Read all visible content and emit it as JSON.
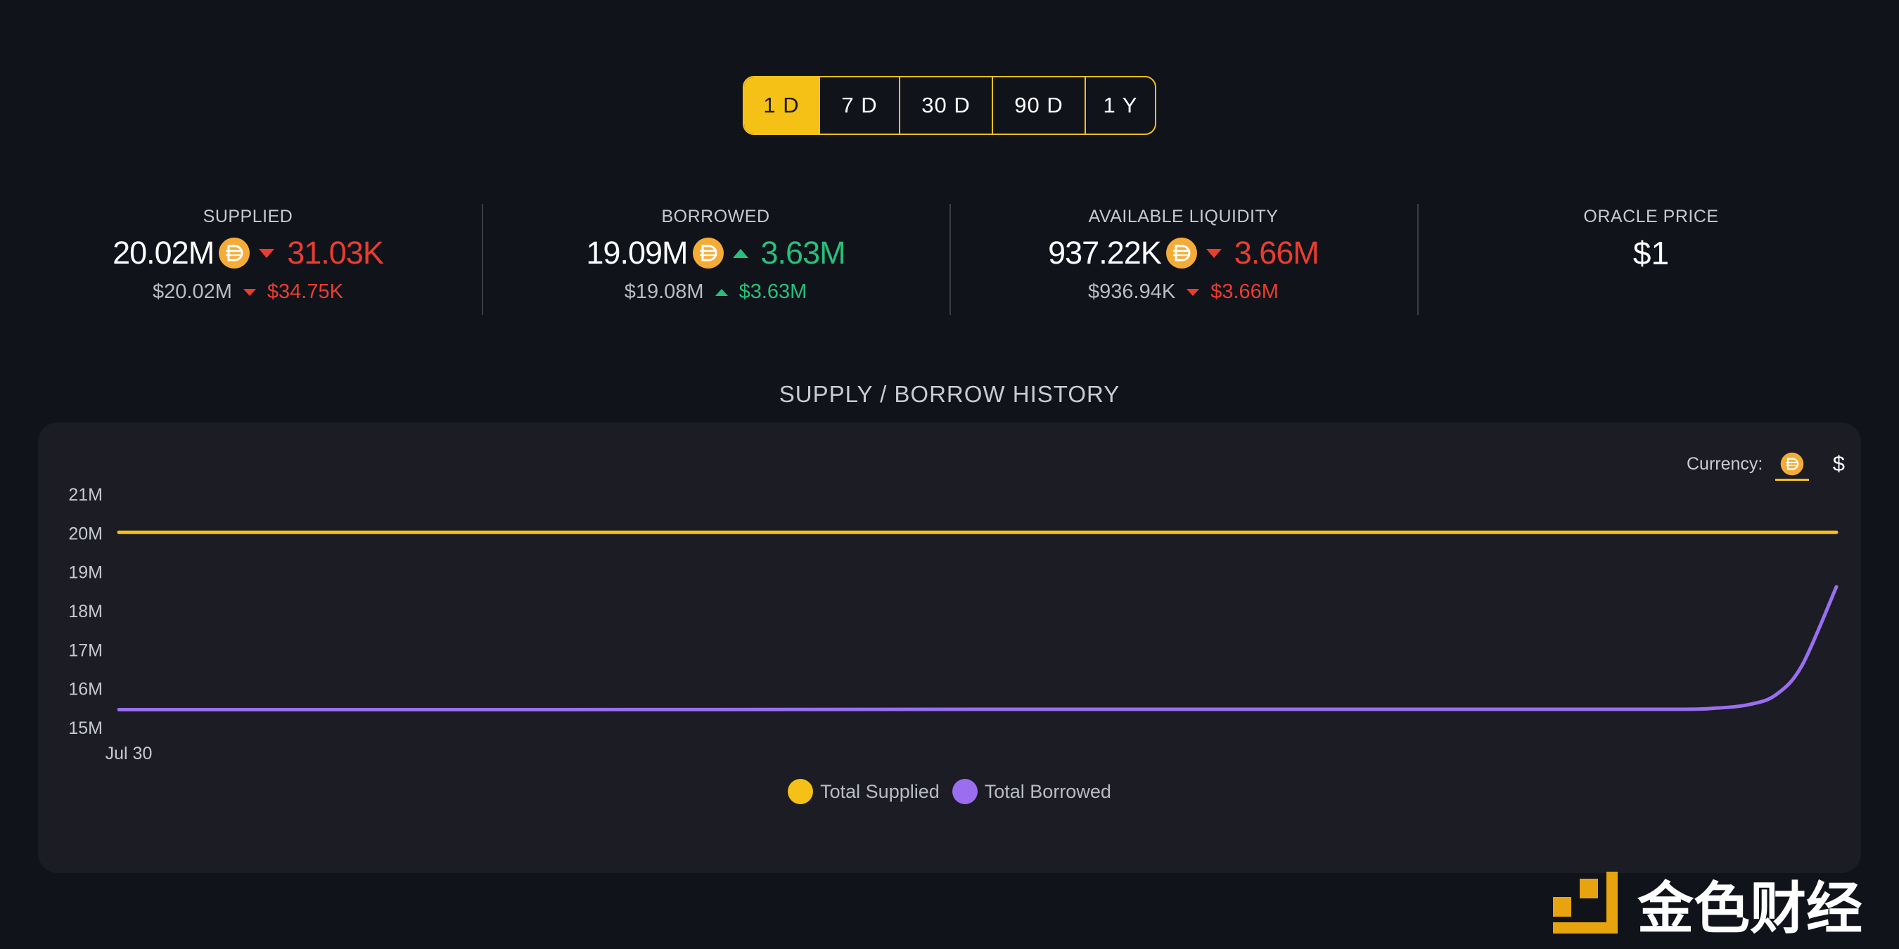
{
  "periods": [
    "1 D",
    "7 D",
    "30 D",
    "90 D",
    "1 Y"
  ],
  "active_period": "1 D",
  "stats": {
    "supplied": {
      "label": "SUPPLIED",
      "value": "20.02M",
      "delta": "31.03K",
      "usd": "$20.02M",
      "usd_delta": "$34.75K",
      "direction": "down"
    },
    "borrowed": {
      "label": "BORROWED",
      "value": "19.09M",
      "delta": "3.63M",
      "usd": "$19.08M",
      "usd_delta": "$3.63M",
      "direction": "up"
    },
    "liquidity": {
      "label": "AVAILABLE LIQUIDITY",
      "value": "937.22K",
      "delta": "3.66M",
      "usd": "$936.94K",
      "usd_delta": "$3.66M",
      "direction": "down"
    },
    "oracle": {
      "label": "ORACLE PRICE",
      "value": "$1"
    }
  },
  "currency": {
    "label": "Currency:",
    "options": [
      "dai-icon",
      "$"
    ],
    "selected": "dai-icon"
  },
  "colors": {
    "accent": "#f5c116",
    "supplied": "#f5c116",
    "borrowed": "#9b6ef0",
    "negative": "#ea3d2f",
    "positive": "#27c07a"
  },
  "watermark": {
    "text": "金色财经"
  },
  "chart_data": {
    "type": "line",
    "title": "SUPPLY / BORROW HISTORY",
    "x_tick_labels": [
      "Jul 30"
    ],
    "y_tick_labels": [
      "21M",
      "20M",
      "19M",
      "18M",
      "17M",
      "16M",
      "15M"
    ],
    "ylim": [
      15,
      21
    ],
    "y_unit": "M",
    "grid": false,
    "legend_position": "bottom",
    "x": [
      0,
      0.25,
      0.5,
      0.75,
      0.9,
      0.93,
      0.95,
      0.965,
      0.98,
      1.0
    ],
    "series": [
      {
        "name": "Total Supplied",
        "values": [
          20.02,
          20.02,
          20.02,
          20.02,
          20.02,
          20.02,
          20.02,
          20.02,
          20.02,
          20.02
        ]
      },
      {
        "name": "Total Borrowed",
        "values": [
          15.46,
          15.46,
          15.47,
          15.47,
          15.47,
          15.5,
          15.6,
          15.85,
          16.6,
          18.62
        ]
      }
    ]
  }
}
